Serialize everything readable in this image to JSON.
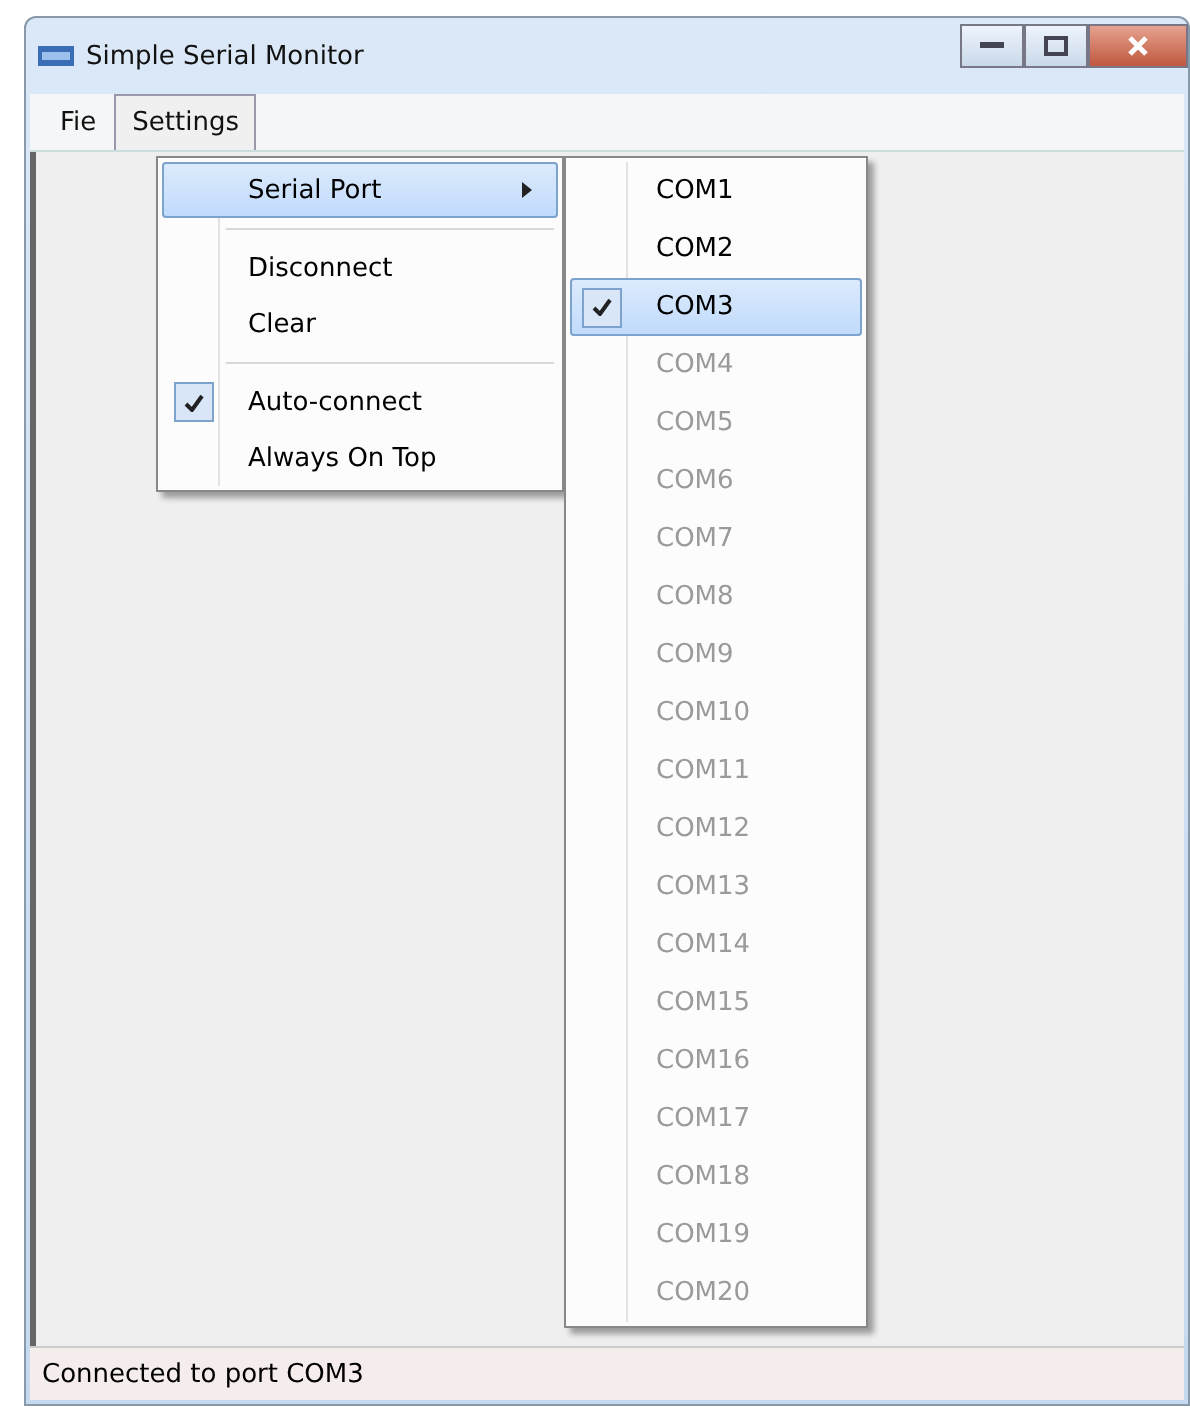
{
  "window": {
    "title": "Simple Serial Monitor"
  },
  "menu_bar": [
    {
      "label": "Fie",
      "selected": false
    },
    {
      "label": "Settings",
      "selected": true
    }
  ],
  "settings_menu": [
    {
      "kind": "submenu",
      "label": "Serial Port",
      "selected": true,
      "checked": false
    },
    {
      "kind": "separator"
    },
    {
      "kind": "item",
      "label": "Disconnect",
      "selected": false,
      "checked": false
    },
    {
      "kind": "item",
      "label": "Clear",
      "selected": false,
      "checked": false
    },
    {
      "kind": "separator"
    },
    {
      "kind": "item",
      "label": "Auto-connect",
      "selected": false,
      "checked": true
    },
    {
      "kind": "item",
      "label": "Always On Top",
      "selected": false,
      "checked": false
    }
  ],
  "serial_port_menu": [
    {
      "label": "COM1",
      "disabled": false,
      "selected": false,
      "checked": false
    },
    {
      "label": "COM2",
      "disabled": false,
      "selected": false,
      "checked": false
    },
    {
      "label": "COM3",
      "disabled": false,
      "selected": true,
      "checked": true
    },
    {
      "label": "COM4",
      "disabled": true,
      "selected": false,
      "checked": false
    },
    {
      "label": "COM5",
      "disabled": true,
      "selected": false,
      "checked": false
    },
    {
      "label": "COM6",
      "disabled": true,
      "selected": false,
      "checked": false
    },
    {
      "label": "COM7",
      "disabled": true,
      "selected": false,
      "checked": false
    },
    {
      "label": "COM8",
      "disabled": true,
      "selected": false,
      "checked": false
    },
    {
      "label": "COM9",
      "disabled": true,
      "selected": false,
      "checked": false
    },
    {
      "label": "COM10",
      "disabled": true,
      "selected": false,
      "checked": false
    },
    {
      "label": "COM11",
      "disabled": true,
      "selected": false,
      "checked": false
    },
    {
      "label": "COM12",
      "disabled": true,
      "selected": false,
      "checked": false
    },
    {
      "label": "COM13",
      "disabled": true,
      "selected": false,
      "checked": false
    },
    {
      "label": "COM14",
      "disabled": true,
      "selected": false,
      "checked": false
    },
    {
      "label": "COM15",
      "disabled": true,
      "selected": false,
      "checked": false
    },
    {
      "label": "COM16",
      "disabled": true,
      "selected": false,
      "checked": false
    },
    {
      "label": "COM17",
      "disabled": true,
      "selected": false,
      "checked": false
    },
    {
      "label": "COM18",
      "disabled": true,
      "selected": false,
      "checked": false
    },
    {
      "label": "COM19",
      "disabled": true,
      "selected": false,
      "checked": false
    },
    {
      "label": "COM20",
      "disabled": true,
      "selected": false,
      "checked": false
    }
  ],
  "status_bar": {
    "text": "Connected to port COM3"
  }
}
